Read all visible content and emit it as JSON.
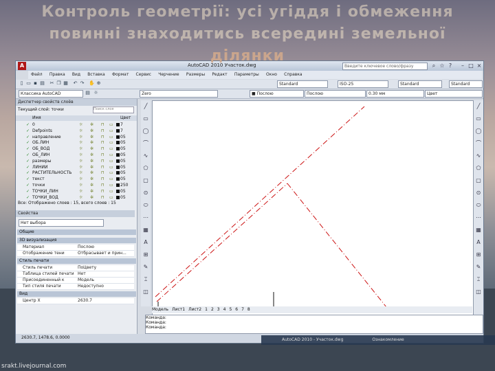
{
  "slide": {
    "title_line1": "Контроль геометрії: усі угіддя і обмеження",
    "title_line2": "повинні знаходитись всередині земельної",
    "title_line3": "ділянки"
  },
  "window": {
    "title": "AutoCAD 2010   Участок.dwg",
    "search_placeholder": "Введите ключевое слово/фразу"
  },
  "menu": [
    "Файл",
    "Правка",
    "Вид",
    "Вставка",
    "Формат",
    "Сервис",
    "Черчение",
    "Размеры",
    "Редакт",
    "Параметры",
    "Окно",
    "Справка"
  ],
  "toolbar": {
    "workspace": "Классика AutoCAD",
    "layer_combo": "Zero",
    "style1": "Standard",
    "style2": "ISO-25",
    "style3": "Standard",
    "style4": "Standard",
    "color": "■ Послою",
    "linetype": "Послою",
    "lineweight": "0.30 мм",
    "plot": "Цвет"
  },
  "layers": {
    "header": "Диспетчер свойств слоёв",
    "current_label": "Текущий слой: точки",
    "search_placeholder": "Поиск слоя",
    "col_name": "Имя",
    "col_color": "Цвет",
    "rows": [
      {
        "name": "0",
        "color": "7"
      },
      {
        "name": "Defpoints",
        "color": "7"
      },
      {
        "name": "направление",
        "color": "05"
      },
      {
        "name": "ОБ.ЛИН",
        "color": "05"
      },
      {
        "name": "ОБ_ВОД",
        "color": "05"
      },
      {
        "name": "ОБ_ЛИН",
        "color": "05"
      },
      {
        "name": "размеры",
        "color": "05"
      },
      {
        "name": "ЛИНИИ",
        "color": "05"
      },
      {
        "name": "РАСТИТЕЛЬНОСТЬ",
        "color": "05"
      },
      {
        "name": "текст",
        "color": "05"
      },
      {
        "name": "точки",
        "color": "250"
      },
      {
        "name": "ТОЧКИ_ЛИН",
        "color": "05"
      },
      {
        "name": "ТОЧКИ_ВОД",
        "color": "05"
      }
    ],
    "footer": "Все: Отображено слоев : 15, всего слоев : 15"
  },
  "properties": {
    "header": "Свойства",
    "selection": "Нет выбора",
    "sections": [
      {
        "title": "Общие",
        "rows": []
      },
      {
        "title": "3D визуализация",
        "rows": [
          {
            "key": "Материал",
            "value": "Послою"
          },
          {
            "key": "Отображение тени",
            "value": "Отбрасывает и прин..."
          }
        ]
      },
      {
        "title": "Стиль печати",
        "rows": [
          {
            "key": "Стиль печати",
            "value": "ПоЦвету"
          },
          {
            "key": "Таблица стилей печати",
            "value": "Нет"
          },
          {
            "key": "Присоединенный к",
            "value": "Модель"
          },
          {
            "key": "Тип стиля печати",
            "value": "Недоступно"
          }
        ]
      },
      {
        "title": "Вид",
        "rows": [
          {
            "key": "Центр X",
            "value": "2630.7"
          }
        ]
      }
    ]
  },
  "layout_tabs": [
    "Модель",
    "Лист1",
    "Лист2",
    "1",
    "2",
    "3",
    "4",
    "5",
    "6",
    "7",
    "8"
  ],
  "command": {
    "line1": "Команда:",
    "line2": "Команда:",
    "line3": "Команда:"
  },
  "status": {
    "coords": "2630.7, 1478.6, 0.0000"
  },
  "taskbar": {
    "item1": "AutoCAD 2010 - Участок.dwg",
    "item2": "Ознакомление"
  },
  "watermark": "srakt.livejournal.com",
  "colors": {
    "autocad_red": "#b01818",
    "line_red": "#cc1111"
  }
}
